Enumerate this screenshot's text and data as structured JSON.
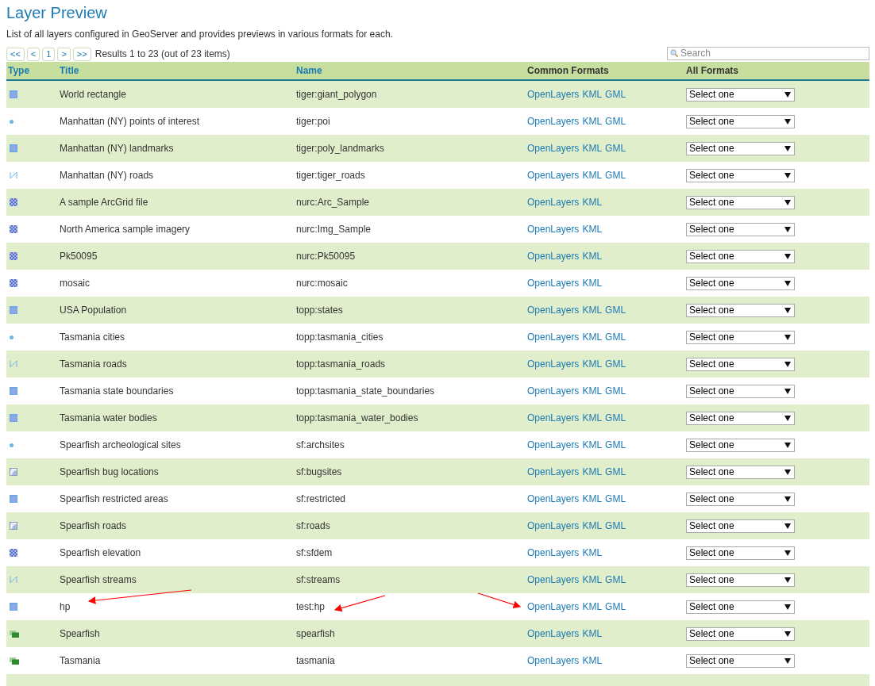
{
  "page": {
    "title": "Layer Preview",
    "description": "List of all layers configured in GeoServer and provides previews in various formats for each."
  },
  "pager": {
    "buttons": [
      {
        "label": "<<"
      },
      {
        "label": "<"
      },
      {
        "label": "1"
      },
      {
        "label": ">"
      },
      {
        "label": ">>"
      }
    ],
    "summary": "Results 1 to 23 (out of 23 items)"
  },
  "search": {
    "placeholder": "Search"
  },
  "table": {
    "columns": [
      "Type",
      "Title",
      "Name",
      "Common Formats",
      "All Formats"
    ],
    "rows": [
      {
        "kind": "polygon",
        "title": "World rectangle",
        "name": "tiger:giant_polygon",
        "formats": [
          "OpenLayers",
          "KML",
          "GML"
        ],
        "select": "Select one"
      },
      {
        "kind": "point",
        "title": "Manhattan (NY) points of interest",
        "name": "tiger:poi",
        "formats": [
          "OpenLayers",
          "KML",
          "GML"
        ],
        "select": "Select one"
      },
      {
        "kind": "polygon",
        "title": "Manhattan (NY) landmarks",
        "name": "tiger:poly_landmarks",
        "formats": [
          "OpenLayers",
          "KML",
          "GML"
        ],
        "select": "Select one"
      },
      {
        "kind": "line",
        "title": "Manhattan (NY) roads",
        "name": "tiger:tiger_roads",
        "formats": [
          "OpenLayers",
          "KML",
          "GML"
        ],
        "select": "Select one"
      },
      {
        "kind": "raster",
        "title": "A sample ArcGrid file",
        "name": "nurc:Arc_Sample",
        "formats": [
          "OpenLayers",
          "KML"
        ],
        "select": "Select one"
      },
      {
        "kind": "raster",
        "title": "North America sample imagery",
        "name": "nurc:Img_Sample",
        "formats": [
          "OpenLayers",
          "KML"
        ],
        "select": "Select one"
      },
      {
        "kind": "raster",
        "title": "Pk50095",
        "name": "nurc:Pk50095",
        "formats": [
          "OpenLayers",
          "KML"
        ],
        "select": "Select one"
      },
      {
        "kind": "raster",
        "title": "mosaic",
        "name": "nurc:mosaic",
        "formats": [
          "OpenLayers",
          "KML"
        ],
        "select": "Select one"
      },
      {
        "kind": "polygon",
        "title": "USA Population",
        "name": "topp:states",
        "formats": [
          "OpenLayers",
          "KML",
          "GML"
        ],
        "select": "Select one"
      },
      {
        "kind": "point",
        "title": "Tasmania cities",
        "name": "topp:tasmania_cities",
        "formats": [
          "OpenLayers",
          "KML",
          "GML"
        ],
        "select": "Select one"
      },
      {
        "kind": "line",
        "title": "Tasmania roads",
        "name": "topp:tasmania_roads",
        "formats": [
          "OpenLayers",
          "KML",
          "GML"
        ],
        "select": "Select one"
      },
      {
        "kind": "polygon",
        "title": "Tasmania state boundaries",
        "name": "topp:tasmania_state_boundaries",
        "formats": [
          "OpenLayers",
          "KML",
          "GML"
        ],
        "select": "Select one"
      },
      {
        "kind": "polygon",
        "title": "Tasmania water bodies",
        "name": "topp:tasmania_water_bodies",
        "formats": [
          "OpenLayers",
          "KML",
          "GML"
        ],
        "select": "Select one"
      },
      {
        "kind": "point",
        "title": "Spearfish archeological sites",
        "name": "sf:archsites",
        "formats": [
          "OpenLayers",
          "KML",
          "GML"
        ],
        "select": "Select one"
      },
      {
        "kind": "vector",
        "title": "Spearfish bug locations",
        "name": "sf:bugsites",
        "formats": [
          "OpenLayers",
          "KML",
          "GML"
        ],
        "select": "Select one"
      },
      {
        "kind": "polygon",
        "title": "Spearfish restricted areas",
        "name": "sf:restricted",
        "formats": [
          "OpenLayers",
          "KML",
          "GML"
        ],
        "select": "Select one"
      },
      {
        "kind": "vector",
        "title": "Spearfish roads",
        "name": "sf:roads",
        "formats": [
          "OpenLayers",
          "KML",
          "GML"
        ],
        "select": "Select one"
      },
      {
        "kind": "raster",
        "title": "Spearfish elevation",
        "name": "sf:sfdem",
        "formats": [
          "OpenLayers",
          "KML"
        ],
        "select": "Select one"
      },
      {
        "kind": "line",
        "title": "Spearfish streams",
        "name": "sf:streams",
        "formats": [
          "OpenLayers",
          "KML",
          "GML"
        ],
        "select": "Select one"
      },
      {
        "kind": "polygon",
        "title": "hp",
        "name": "test:hp",
        "formats": [
          "OpenLayers",
          "KML",
          "GML"
        ],
        "select": "Select one"
      },
      {
        "kind": "group",
        "title": "Spearfish",
        "name": "spearfish",
        "formats": [
          "OpenLayers",
          "KML"
        ],
        "select": "Select one"
      },
      {
        "kind": "group",
        "title": "Tasmania",
        "name": "tasmania",
        "formats": [
          "OpenLayers",
          "KML"
        ],
        "select": "Select one"
      }
    ]
  }
}
